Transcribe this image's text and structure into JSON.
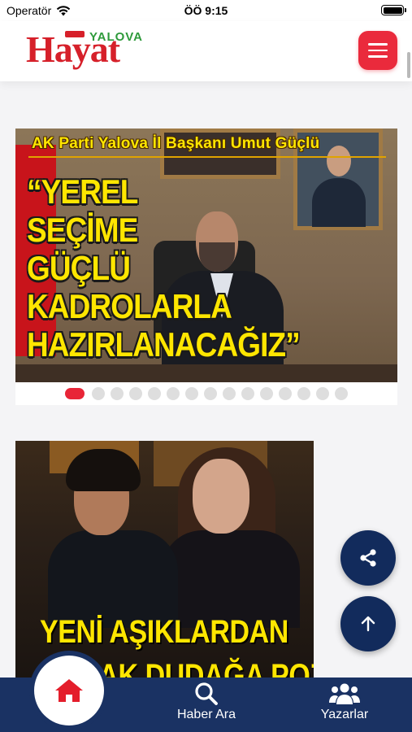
{
  "status_bar": {
    "carrier": "Operatör",
    "time": "ÖÖ 9:15"
  },
  "header": {
    "logo_small": "YALOVA",
    "logo_big": "Hayat"
  },
  "slider": {
    "active_index": 0,
    "dot_count": 15,
    "slides": [
      {
        "subtitle": "AK Parti Yalova İl Başkanı Umut Güçlü",
        "headline_lines": [
          "“YEREL",
          "SEÇİME",
          "GÜÇLÜ",
          "KADROLARLA",
          "HAZIRLANACAĞIZ”"
        ]
      }
    ]
  },
  "article2": {
    "headline_lines": [
      "YENİ AŞIKLARDAN",
      "DUDAK DUDAĞA POZ"
    ]
  },
  "tabbar": {
    "home_icon": "home-icon",
    "search_label": "Haber Ara",
    "writers_label": "Yazarlar"
  },
  "colors": {
    "accent_red": "#ea2a3c",
    "navy": "#1a3263",
    "headline_yellow": "#ffe600"
  }
}
